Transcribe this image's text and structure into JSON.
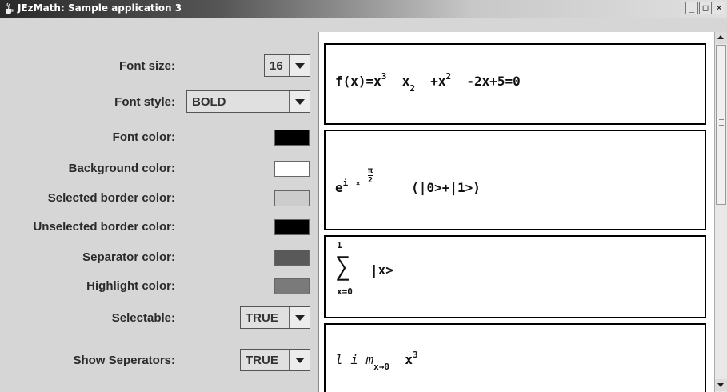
{
  "window": {
    "title": "JEzMath: Sample application 3",
    "icon": "java-cup-icon",
    "minimize_label": "_",
    "maximize_label": "□",
    "close_label": "×"
  },
  "settings": {
    "font_size": {
      "label": "Font size:",
      "value": "16"
    },
    "font_style": {
      "label": "Font style:",
      "value": "BOLD"
    },
    "font_color": {
      "label": "Font color:",
      "color": "#000000"
    },
    "background_color": {
      "label": "Background color:",
      "color": "#ffffff"
    },
    "selected_border_color": {
      "label": "Selected border color:",
      "color": "#cccccc"
    },
    "unselected_border_color": {
      "label": "Unselected border color:",
      "color": "#000000"
    },
    "separator_color": {
      "label": "Separator color:",
      "color": "#595959"
    },
    "highlight_color": {
      "label": "Highlight color:",
      "color": "#7a7a7a"
    },
    "selectable": {
      "label": "Selectable:",
      "value": "TRUE"
    },
    "show_separators": {
      "label": "Show Seperators:",
      "value": "TRUE"
    }
  },
  "formulas": {
    "f1": {
      "fx": "f(x)=x",
      "p3": "3",
      "x": "x",
      "s2": "2",
      "plus": "+x",
      "p2": "2",
      "rest": "-2x+5=0"
    },
    "f2": {
      "e": "e",
      "i": "i",
      "times": "×",
      "pi": "π",
      "two": "2",
      "ket": "(|0>+|1>)"
    },
    "f3": {
      "upper": "1",
      "sigma": "∑",
      "lower": "x=0",
      "ket": "|x>"
    },
    "f4": {
      "lim": "l i m",
      "sub": "x→0",
      "x": "x",
      "p3": "3"
    }
  },
  "scrollbar": {
    "up_icon": "arrow-up-icon",
    "down_icon": "arrow-down-icon"
  }
}
